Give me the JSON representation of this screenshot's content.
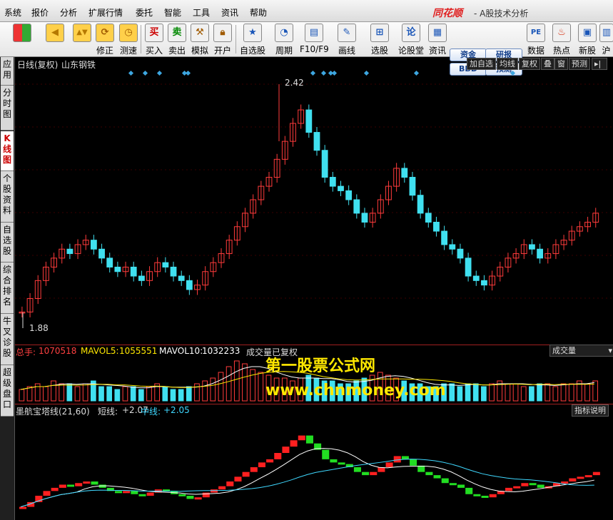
{
  "menu": [
    "系统",
    "报价",
    "分析",
    "扩展行情",
    "委托",
    "智能",
    "工具",
    "资讯",
    "帮助"
  ],
  "brand": "同花顺",
  "app_title": "- A股技术分析",
  "toolbar": [
    {
      "name": "layout",
      "label": ""
    },
    {
      "name": "back",
      "label": ""
    },
    {
      "name": "updown",
      "label": ""
    },
    {
      "name": "correct",
      "label": "修正"
    },
    {
      "name": "speed",
      "label": "测速"
    },
    {
      "name": "buy",
      "label": "买入",
      "glyph": "买"
    },
    {
      "name": "sell",
      "label": "卖出",
      "glyph": "卖"
    },
    {
      "name": "simulate",
      "label": "模拟"
    },
    {
      "name": "open-account",
      "label": "开户"
    },
    {
      "name": "self-select",
      "label": "自选股"
    },
    {
      "name": "period",
      "label": "周期"
    },
    {
      "name": "f10",
      "label": "F10/F9"
    },
    {
      "name": "draw-line",
      "label": "画线"
    },
    {
      "name": "stock-pick",
      "label": "选股"
    },
    {
      "name": "forum",
      "label": "论股堂",
      "glyph": "论"
    },
    {
      "name": "news",
      "label": "资讯"
    },
    {
      "name": "data",
      "label": "数据"
    },
    {
      "name": "hot",
      "label": "热点"
    },
    {
      "name": "new-stock",
      "label": "新股"
    },
    {
      "name": "sh-sz",
      "label": "沪"
    }
  ],
  "toolbar_pills": [
    "资金",
    "研报",
    "BBD",
    "预测"
  ],
  "sidebar": [
    "应用",
    "分时图",
    "K线图",
    "个股资料",
    "自选股",
    "综合排名",
    "牛叉诊股",
    "超级盘口"
  ],
  "kline_header": {
    "period": "日线(复权)",
    "stock": "山东钢铁"
  },
  "kline_buttons": [
    "加自选",
    "均线",
    "复权",
    "叠",
    "窗",
    "预测"
  ],
  "kline_labels": {
    "high": "2.42",
    "low": "1.88"
  },
  "volume_header": {
    "total_label": "总手:",
    "total": "1070518",
    "ma5_label": "MAVOL5:",
    "ma5": "1055551",
    "ma10_label": "MAVOL10:",
    "ma10": "1032233",
    "note": "成交量已复权",
    "dropdown": "成交量"
  },
  "indicator_header": {
    "name": "墨航宝塔线(21,60)",
    "short_label": "短线:",
    "short": "+2.07",
    "mid_label": "中线:",
    "mid": "+2.05",
    "explain": "指标说明"
  },
  "watermark": {
    "line1": "第一股票公式网",
    "line2": "www.chnmoney.com"
  },
  "colors": {
    "up": "#ff3b3b",
    "down": "#40e0f0",
    "tower_up": "#ff2020",
    "tower_down": "#22dd22",
    "diamond": "#3da6e0",
    "yellow": "#ffe800"
  },
  "chart_data": {
    "type": "candlestick",
    "y_range": [
      1.88,
      2.42
    ],
    "close_series": [
      1.9,
      1.93,
      1.97,
      2.0,
      2.02,
      2.04,
      2.03,
      2.05,
      2.06,
      2.04,
      2.02,
      2.0,
      1.99,
      2.0,
      1.98,
      1.97,
      1.99,
      2.01,
      2.0,
      1.98,
      1.97,
      1.95,
      1.96,
      1.99,
      2.01,
      2.03,
      2.06,
      2.09,
      2.12,
      2.15,
      2.18,
      2.2,
      2.24,
      2.28,
      2.32,
      2.35,
      2.3,
      2.26,
      2.2,
      2.18,
      2.17,
      2.15,
      2.12,
      2.1,
      2.12,
      2.15,
      2.18,
      2.22,
      2.2,
      2.16,
      2.12,
      2.1,
      2.08,
      2.05,
      2.04,
      2.02,
      1.98,
      1.97,
      1.96,
      1.98,
      2.0,
      2.02,
      2.03,
      2.05,
      2.04,
      2.02,
      2.03,
      2.05,
      2.06,
      2.08,
      2.09,
      2.1,
      2.12
    ],
    "volume_series": [
      0.4,
      0.5,
      0.6,
      0.5,
      0.7,
      0.6,
      0.6,
      0.5,
      0.6,
      0.7,
      0.5,
      0.5,
      0.4,
      0.5,
      0.5,
      0.4,
      0.5,
      0.6,
      0.5,
      0.4,
      0.4,
      0.5,
      0.6,
      0.7,
      0.8,
      1.0,
      1.2,
      1.4,
      1.3,
      1.1,
      1.0,
      0.9,
      0.8,
      0.8,
      0.7,
      0.8,
      0.9,
      0.8,
      0.7,
      0.7,
      0.6,
      0.6,
      0.7,
      0.8,
      0.9,
      1.0,
      0.9,
      0.8,
      0.7,
      0.6,
      0.6,
      0.5,
      0.5,
      0.6,
      0.6,
      0.5,
      0.6,
      0.6,
      0.5,
      0.6,
      0.7,
      0.6,
      0.6,
      0.5,
      0.5,
      0.6,
      0.6,
      0.5,
      0.6,
      0.6,
      0.7,
      0.6,
      0.7
    ]
  }
}
